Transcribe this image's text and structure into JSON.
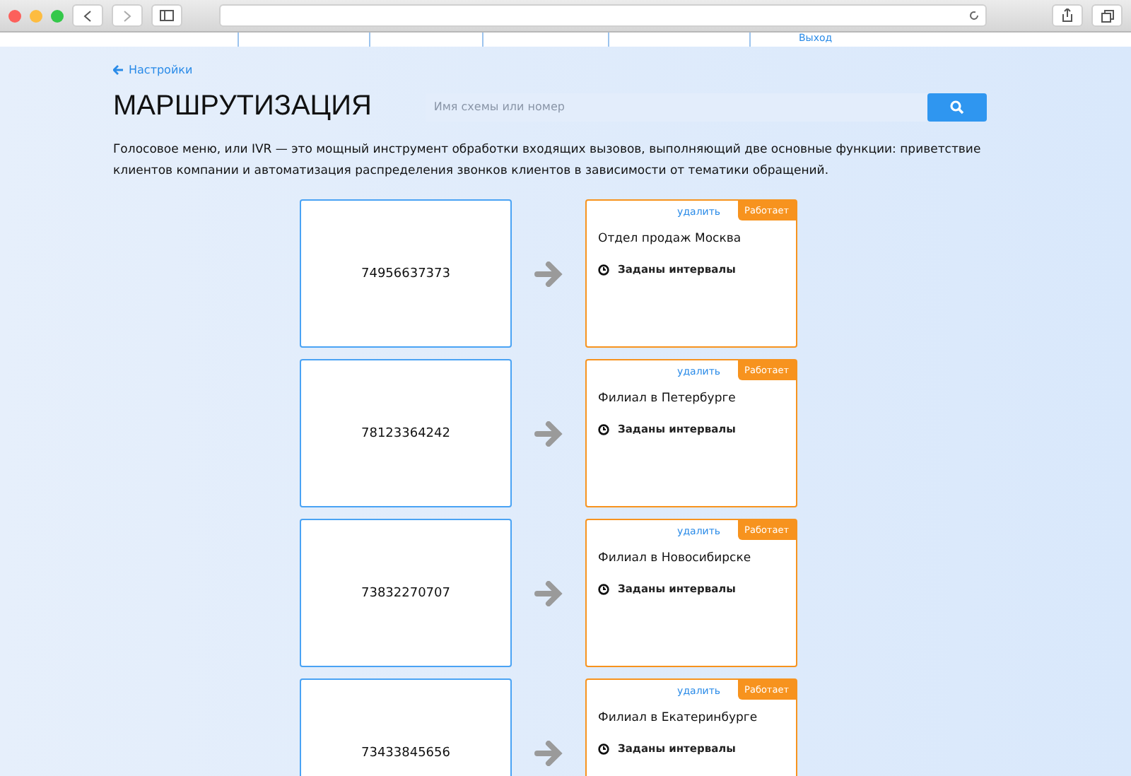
{
  "header": {
    "logout": "Выход"
  },
  "back_link": "Настройки",
  "title": "МАРШРУТИЗАЦИЯ",
  "search": {
    "placeholder": "Имя схемы или номер"
  },
  "description": "Голосовое меню, или IVR — это мощный инструмент обработки входящих вызовов, выполняющий две основные функции: приветствие клиентов компании и автоматизация распределения звонков клиентов в зависимости от тематики обращений.",
  "routes": [
    {
      "number": "74956637373",
      "scheme": "Отдел продаж Москва",
      "delete": "удалить",
      "status": "Работает",
      "schedule": "Заданы интервалы"
    },
    {
      "number": "78123364242",
      "scheme": "Филиал в Петербурге",
      "delete": "удалить",
      "status": "Работает",
      "schedule": "Заданы интервалы"
    },
    {
      "number": "73832270707",
      "scheme": "Филиал в Новосибирске",
      "delete": "удалить",
      "status": "Работает",
      "schedule": "Заданы интервалы"
    },
    {
      "number": "73433845656",
      "scheme": "Филиал в Екатеринбурге",
      "delete": "удалить",
      "status": "Работает",
      "schedule": "Заданы интервалы"
    }
  ]
}
